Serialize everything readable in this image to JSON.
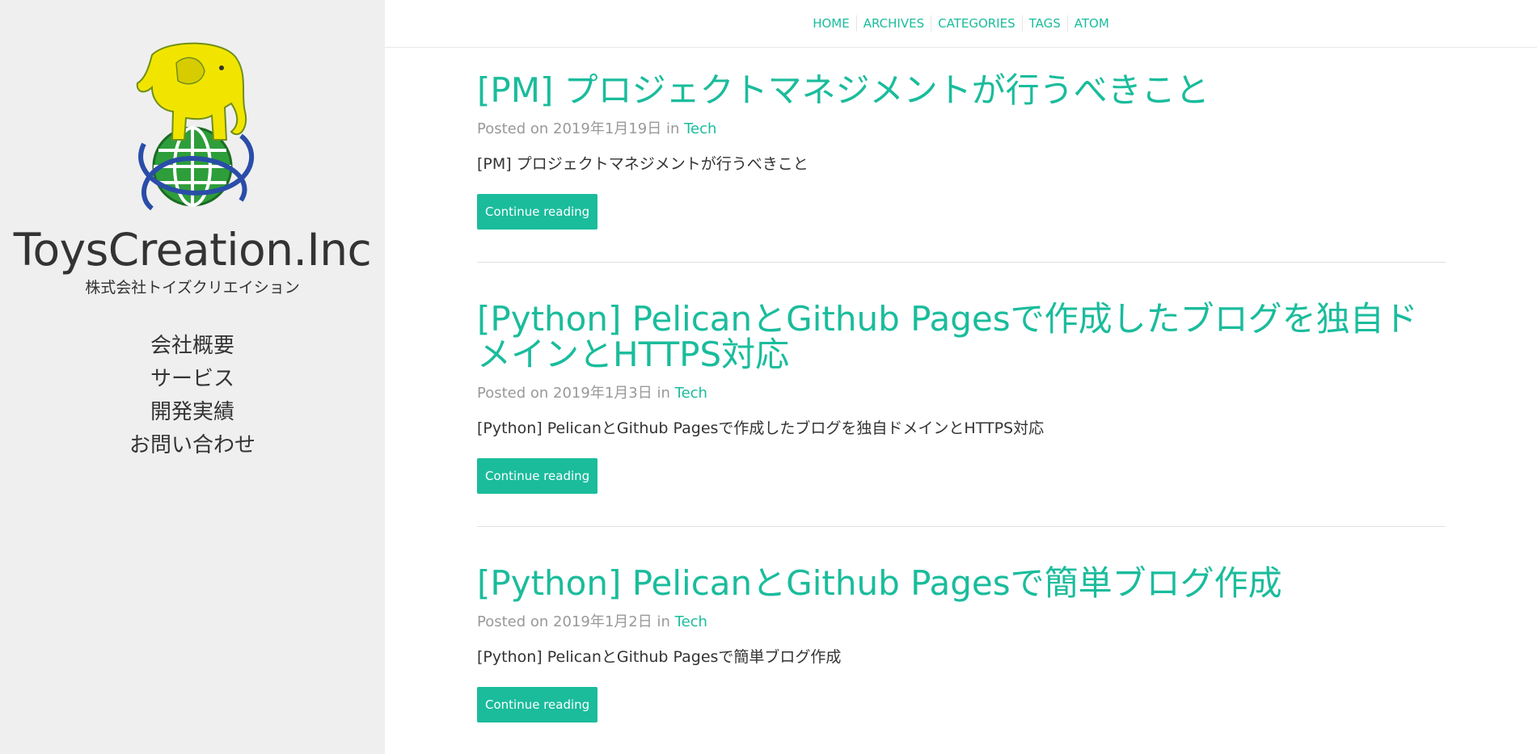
{
  "sidebar": {
    "logo_icon": "elephant-on-globe-logo",
    "title": "ToysCreation.Inc",
    "subtitle": "株式会社トイズクリエイション",
    "nav": [
      {
        "label": "会社概要"
      },
      {
        "label": "サービス"
      },
      {
        "label": "開発実績"
      },
      {
        "label": "お問い合わせ"
      }
    ]
  },
  "topnav": [
    {
      "label": "HOME"
    },
    {
      "label": "ARCHIVES"
    },
    {
      "label": "CATEGORIES"
    },
    {
      "label": "TAGS"
    },
    {
      "label": "ATOM"
    }
  ],
  "posts": [
    {
      "title": "[PM] プロジェクトマネジメントが行うべきこと",
      "posted_on": "Posted on 2019年1月19日",
      "in": "in",
      "category": "Tech",
      "summary": "[PM] プロジェクトマネジメントが行うべきこと",
      "button": "Continue reading"
    },
    {
      "title": "[Python] PelicanとGithub Pagesで作成したブログを独自ドメインとHTTPS対応",
      "posted_on": "Posted on 2019年1月3日",
      "in": "in",
      "category": "Tech",
      "summary": "[Python] PelicanとGithub Pagesで作成したブログを独自ドメインとHTTPS対応",
      "button": "Continue reading"
    },
    {
      "title": "[Python] PelicanとGithub Pagesで簡単ブログ作成",
      "posted_on": "Posted on 2019年1月2日",
      "in": "in",
      "category": "Tech",
      "summary": "[Python] PelicanとGithub Pagesで簡単ブログ作成",
      "button": "Continue reading"
    }
  ],
  "colors": {
    "accent": "#1abc9c",
    "sidebar_bg": "#efefef",
    "text": "#333333",
    "meta": "#999999"
  }
}
